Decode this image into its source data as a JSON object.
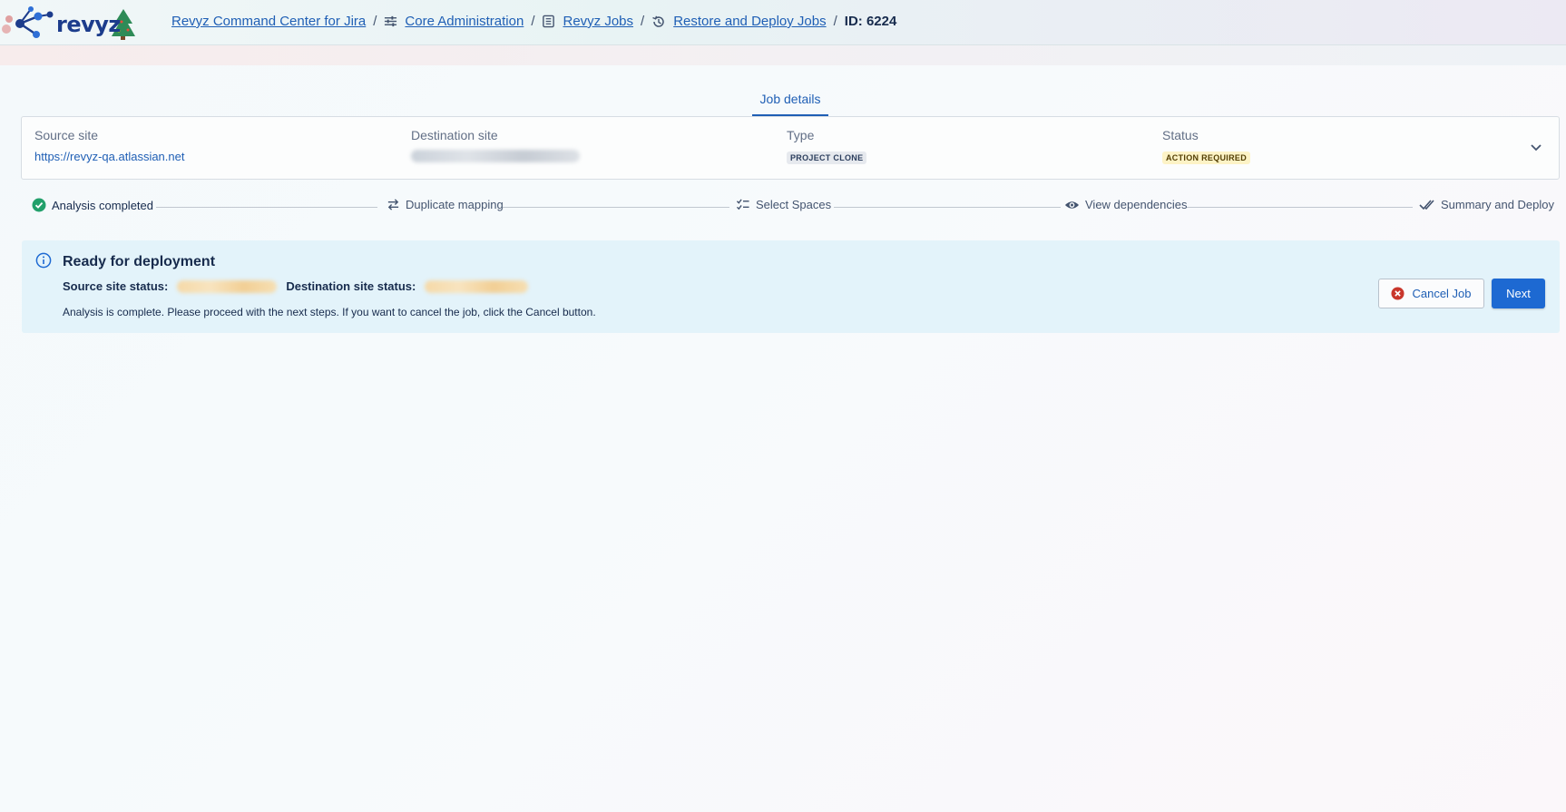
{
  "header": {
    "logo_text": "revyz",
    "breadcrumb": [
      {
        "label": "Revyz Command Center for Jira",
        "icon": "none"
      },
      {
        "label": "Core Administration",
        "icon": "sliders-icon"
      },
      {
        "label": "Revyz Jobs",
        "icon": "list-icon"
      },
      {
        "label": "Restore and Deploy Jobs",
        "icon": "history-icon"
      }
    ],
    "separator": "/",
    "current": "ID: 6224"
  },
  "tabs": {
    "active": "Job details"
  },
  "details": {
    "source_label": "Source site",
    "source_value": "https://revyz-qa.atlassian.net",
    "destination_label": "Destination site",
    "type_label": "Type",
    "type_value": "PROJECT CLONE",
    "status_label": "Status",
    "status_value": "ACTION REQUIRED"
  },
  "stepper": {
    "steps": [
      {
        "label": "Analysis completed",
        "icon": "check-circle-icon",
        "state": "done"
      },
      {
        "label": "Duplicate mapping",
        "icon": "swap-icon",
        "state": "pending"
      },
      {
        "label": "Select Spaces",
        "icon": "checklist-icon",
        "state": "pending"
      },
      {
        "label": "View dependencies",
        "icon": "eye-icon",
        "state": "pending"
      },
      {
        "label": "Summary and Deploy",
        "icon": "double-check-icon",
        "state": "pending"
      }
    ]
  },
  "banner": {
    "title": "Ready for deployment",
    "source_status_label": "Source site status:",
    "destination_status_label": "Destination site status:",
    "message": "Analysis is complete. Please proceed with the next steps. If you want to cancel the job, click the Cancel button.",
    "cancel_label": "Cancel Job",
    "next_label": "Next"
  },
  "colors": {
    "primary": "#1d69d2",
    "link": "#1f5fb5",
    "success": "#22a06b",
    "danger": "#c9372c",
    "banner_bg": "#e3f3fa"
  }
}
